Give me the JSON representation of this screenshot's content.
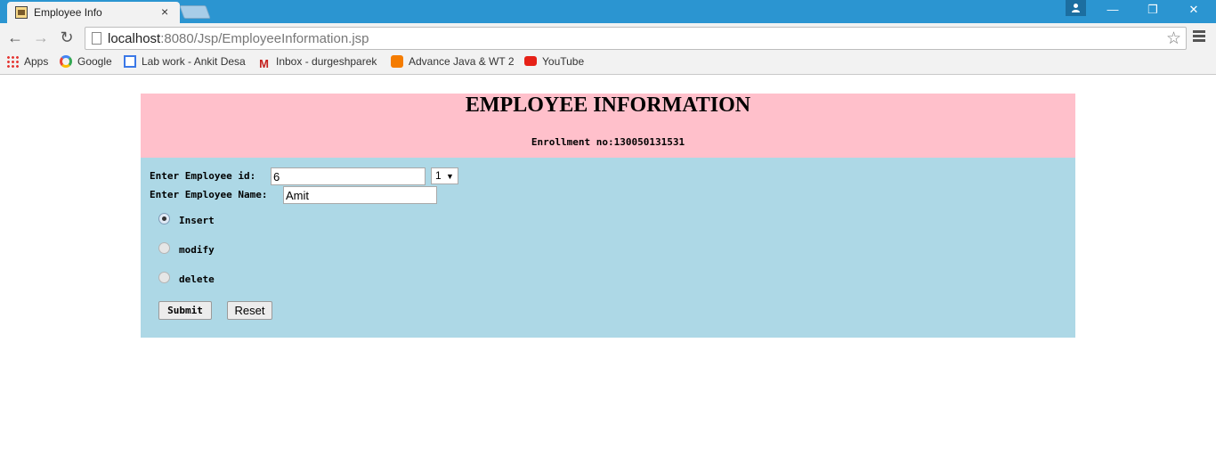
{
  "browser": {
    "tab_title": "Employee Info",
    "tab_close": "×",
    "url_host": "localhost",
    "url_rest": ":8080/Jsp/EmployeeInformation.jsp",
    "window_controls": {
      "minimize": "—",
      "restore": "❐",
      "close": "✕"
    },
    "nav": {
      "back": "←",
      "forward": "→",
      "reload": "↻"
    },
    "bookmarks": [
      {
        "label": "Apps",
        "icon": "apps-grid-icon"
      },
      {
        "label": "Google",
        "icon": "google-icon"
      },
      {
        "label": "Lab work - Ankit Desa",
        "icon": "doc-icon"
      },
      {
        "label": "Inbox - durgeshparek",
        "icon": "gmail-icon"
      },
      {
        "label": "Advance Java & WT 2",
        "icon": "blogger-icon"
      },
      {
        "label": "YouTube",
        "icon": "youtube-icon"
      }
    ],
    "star": "☆"
  },
  "page": {
    "heading": "EMPLOYEE INFORMATION",
    "enrollment": "Enrollment no:130050131531",
    "form": {
      "id_label": "Enter Employee id:",
      "id_value": "6",
      "select_value": "1",
      "name_label": "Enter Employee Name:",
      "name_value": "Amit",
      "radios": [
        {
          "label": "Insert",
          "checked": true
        },
        {
          "label": "modify",
          "checked": false
        },
        {
          "label": "delete",
          "checked": false
        }
      ],
      "submit_label": "Submit",
      "reset_label": "Reset"
    }
  },
  "colors": {
    "titlebar": "#2b95d1",
    "header_bg": "#ffc0cb",
    "form_bg": "#add8e6"
  }
}
